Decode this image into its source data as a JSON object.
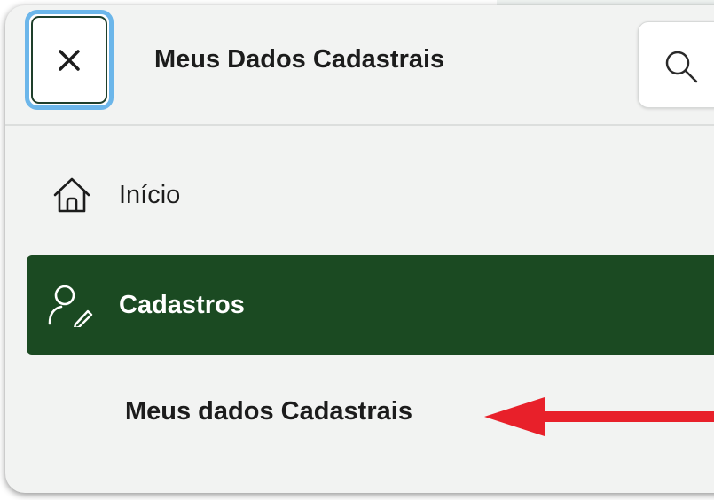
{
  "header": {
    "title": "Meus Dados Cadastrais",
    "close_icon": "close-icon",
    "search_icon": "search-icon"
  },
  "nav": {
    "items": [
      {
        "label": "Início",
        "icon": "home-icon",
        "active": false
      },
      {
        "label": "Cadastros",
        "icon": "user-edit-icon",
        "active": true
      }
    ],
    "subitems": [
      {
        "label": "Meus dados Cadastrais"
      }
    ]
  },
  "annotation": {
    "arrow_icon": "arrow-left-icon",
    "arrow_color": "#e8202a"
  },
  "colors": {
    "active_bg": "#1b4a22",
    "focus_ring": "#6cb6ea",
    "panel_bg": "#f2f3f2"
  }
}
